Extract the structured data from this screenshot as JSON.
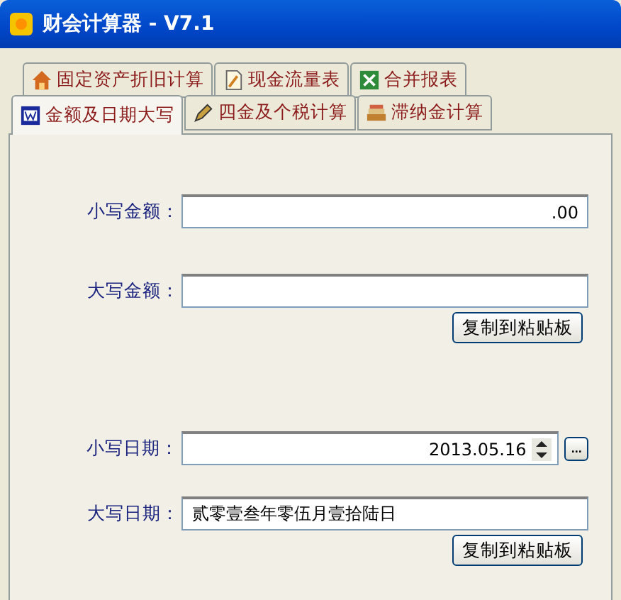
{
  "window": {
    "title": "财会计算器 - V7.1"
  },
  "tab_rows": [
    [
      {
        "label": "固定资产折旧计算",
        "selected": false
      },
      {
        "label": "现金流量表",
        "selected": false
      },
      {
        "label": "合并报表",
        "selected": false
      }
    ],
    [
      {
        "label": "金额及日期大写",
        "selected": true
      },
      {
        "label": "四金及个税计算",
        "selected": false
      },
      {
        "label": "滞纳金计算",
        "selected": false
      }
    ]
  ],
  "amount": {
    "small_label": "小写金额：",
    "small_value": ".00",
    "big_label": "大写金额：",
    "copy_button": "复制到粘贴板"
  },
  "date": {
    "small_label": "小写日期：",
    "small_value": "2013.05.16",
    "picker_button": "...",
    "big_label": "大写日期：",
    "big_value": "贰零壹叁年零伍月壹拾陆日",
    "copy_button": "复制到粘贴板"
  }
}
